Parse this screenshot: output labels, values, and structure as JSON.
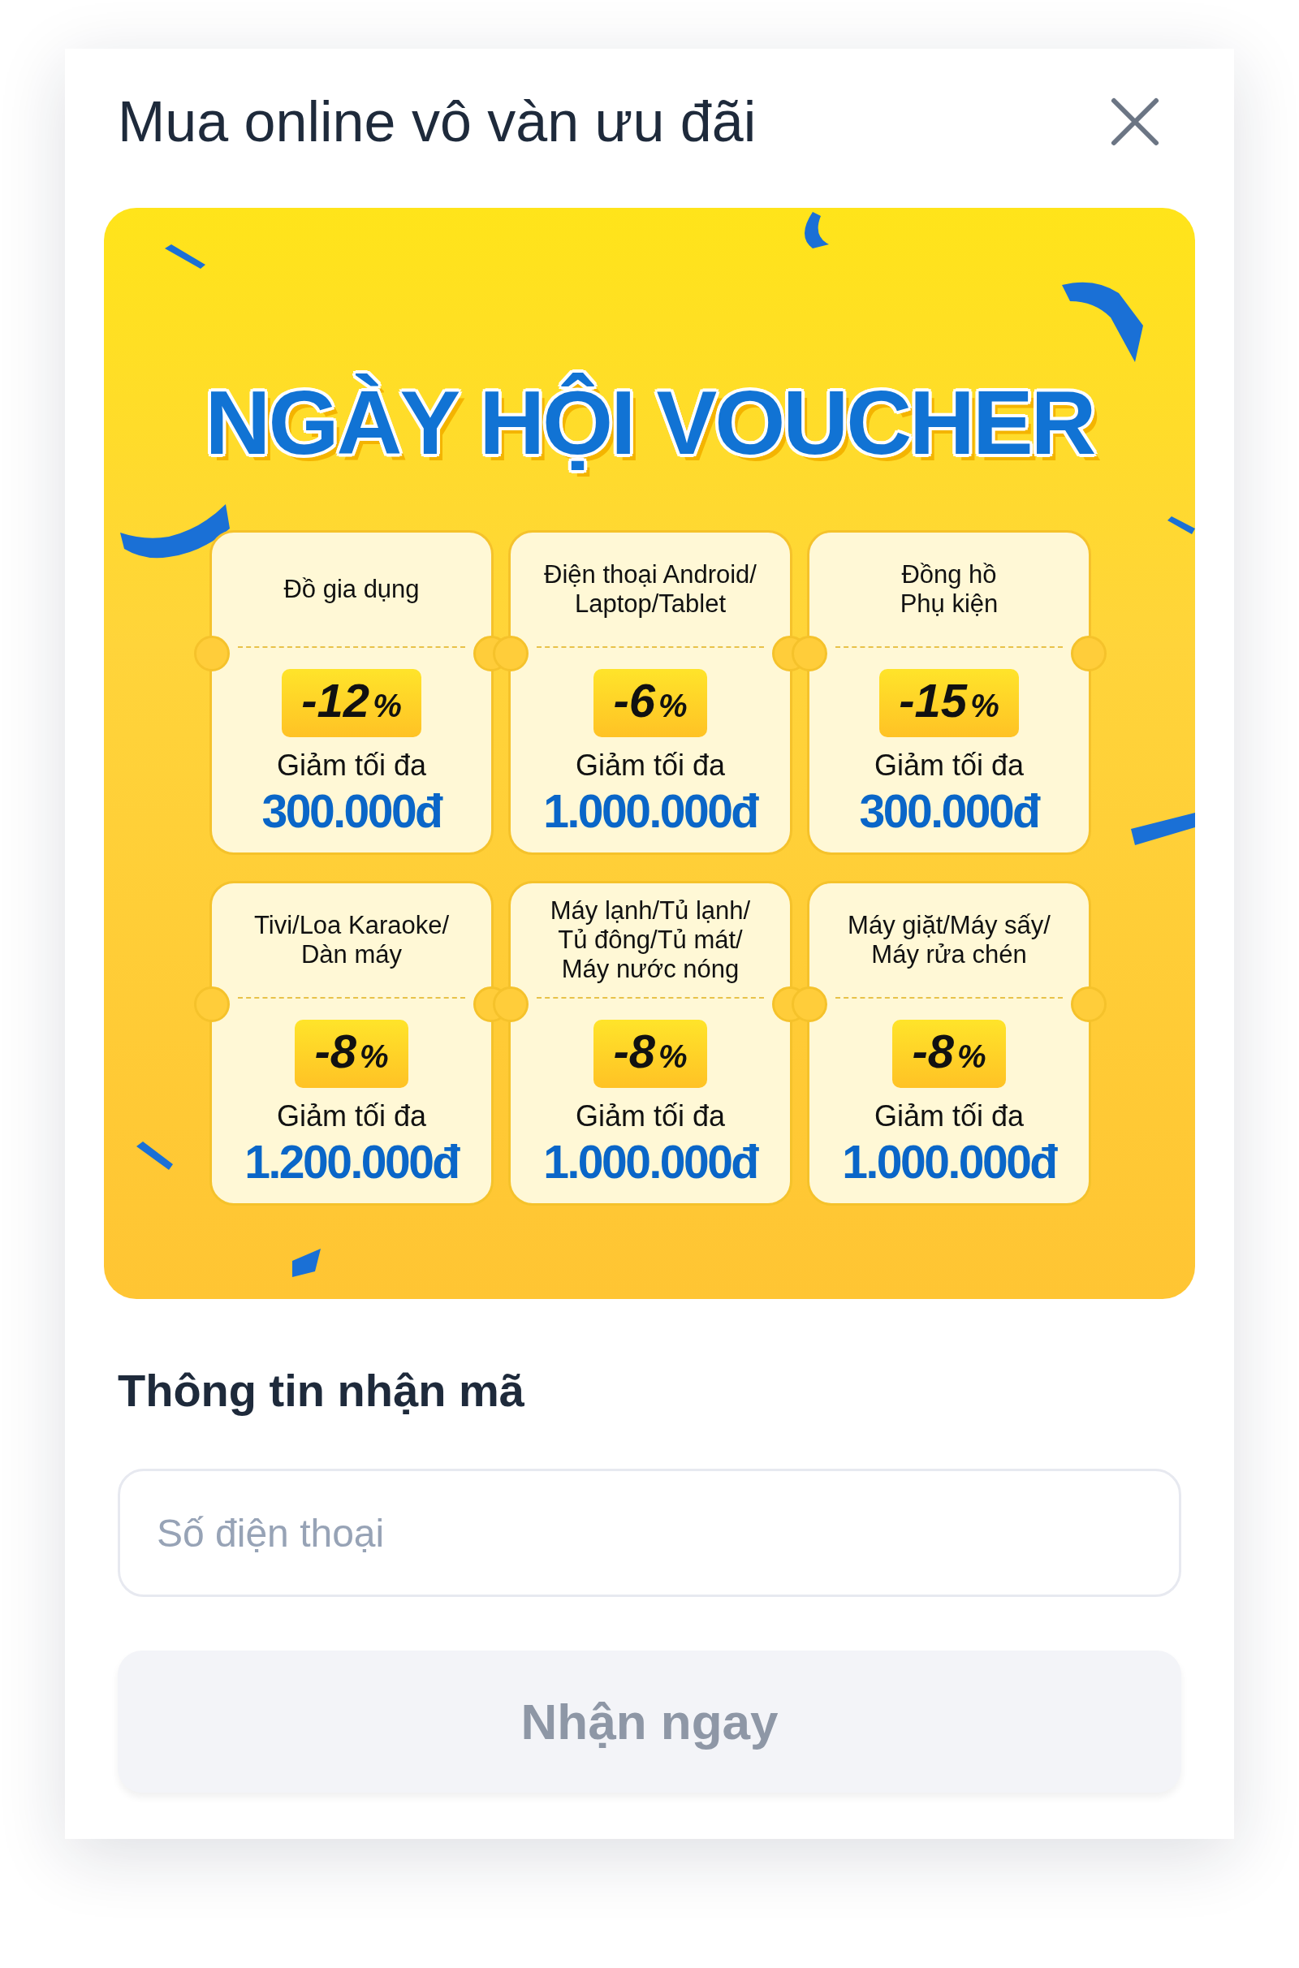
{
  "dialog": {
    "title": "Mua online vô vàn ưu đãi"
  },
  "banner": {
    "title": "NGÀY HỘI VOUCHER",
    "vouchers": [
      {
        "category": "Đồ gia dụng",
        "discount": "-12",
        "unit": "%",
        "caption": "Giảm tối đa",
        "amount": "300.000đ"
      },
      {
        "category": "Điện thoại Android/\nLaptop/Tablet",
        "discount": "-6",
        "unit": "%",
        "caption": "Giảm tối đa",
        "amount": "1.000.000đ"
      },
      {
        "category": "Đồng hồ\nPhụ kiện",
        "discount": "-15",
        "unit": "%",
        "caption": "Giảm tối đa",
        "amount": "300.000đ"
      },
      {
        "category": "Tivi/Loa Karaoke/\nDàn máy",
        "discount": "-8",
        "unit": "%",
        "caption": "Giảm tối đa",
        "amount": "1.200.000đ"
      },
      {
        "category": "Máy lạnh/Tủ lạnh/\nTủ đông/Tủ mát/\nMáy nước nóng",
        "discount": "-8",
        "unit": "%",
        "caption": "Giảm tối đa",
        "amount": "1.000.000đ"
      },
      {
        "category": "Máy giặt/Máy sấy/\nMáy rửa chén",
        "discount": "-8",
        "unit": "%",
        "caption": "Giảm tối đa",
        "amount": "1.000.000đ"
      }
    ]
  },
  "form": {
    "heading": "Thông tin nhận mã",
    "phone": {
      "placeholder": "Số điện thoại"
    },
    "submit": {
      "label": "Nhận ngay",
      "disabled": true
    }
  }
}
